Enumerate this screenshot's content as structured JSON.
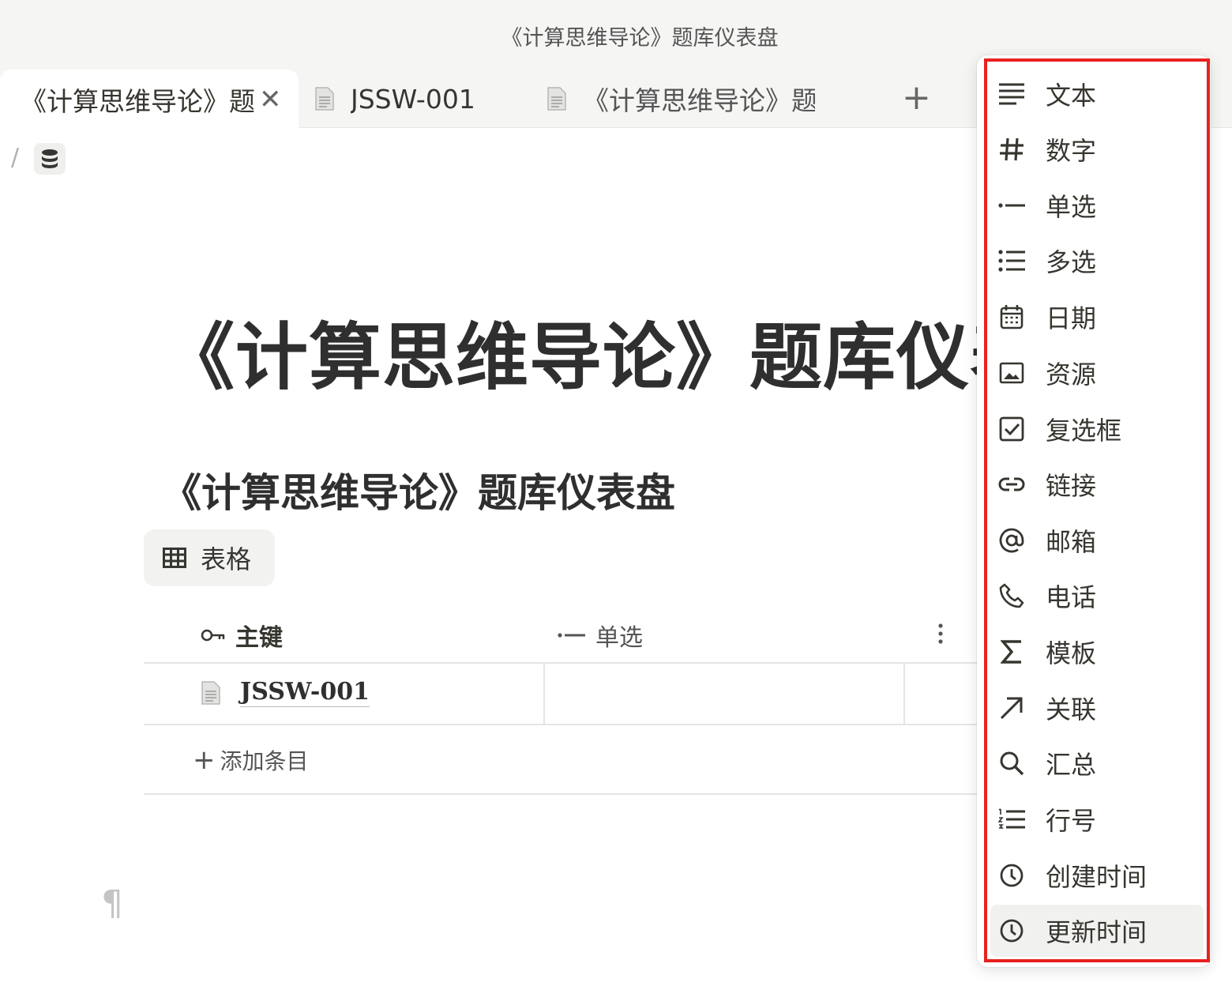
{
  "window": {
    "title": "《计算思维导论》题库仪表盘"
  },
  "tabs": [
    {
      "label": "《计算思维导论》题库仪表盘",
      "active": true
    },
    {
      "label": "JSSW-001",
      "active": false
    },
    {
      "label": "《计算思维导论》题库仪表盘",
      "active": false
    }
  ],
  "breadcrumb": {
    "separator": "/"
  },
  "page": {
    "title": "《计算思维导论》题库仪表盘",
    "database_title": "《计算思维导论》题库仪表盘",
    "view_label": "表格",
    "paragraph_mark": "¶"
  },
  "table": {
    "columns": [
      {
        "label": "主键",
        "icon": "key-icon"
      },
      {
        "label": "单选",
        "icon": "single-select-icon"
      }
    ],
    "rows": [
      {
        "title": "JSSW-001"
      }
    ],
    "add_entry_label": "添加条目"
  },
  "menu": {
    "items": [
      {
        "label": "文本",
        "icon": "text-icon"
      },
      {
        "label": "数字",
        "icon": "hash-icon"
      },
      {
        "label": "单选",
        "icon": "single-select-icon"
      },
      {
        "label": "多选",
        "icon": "multi-select-icon"
      },
      {
        "label": "日期",
        "icon": "calendar-icon"
      },
      {
        "label": "资源",
        "icon": "image-icon"
      },
      {
        "label": "复选框",
        "icon": "checkbox-icon"
      },
      {
        "label": "链接",
        "icon": "link-icon"
      },
      {
        "label": "邮箱",
        "icon": "at-icon"
      },
      {
        "label": "电话",
        "icon": "phone-icon"
      },
      {
        "label": "模板",
        "icon": "sigma-icon"
      },
      {
        "label": "关联",
        "icon": "arrow-up-right-icon"
      },
      {
        "label": "汇总",
        "icon": "search-icon"
      },
      {
        "label": "行号",
        "icon": "numbered-list-icon"
      },
      {
        "label": "创建时间",
        "icon": "clock-icon"
      },
      {
        "label": "更新时间",
        "icon": "clock-icon",
        "hovered": true
      }
    ],
    "highlight_color": "#e8211f"
  }
}
